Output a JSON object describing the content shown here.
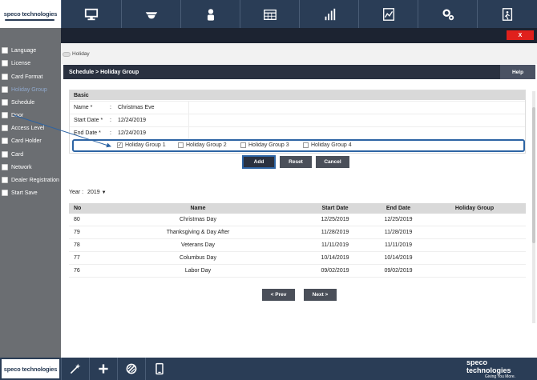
{
  "brand": {
    "logo_text": "speco technologies",
    "tagline": "Giving You More."
  },
  "nav": {
    "items": [
      {
        "icon": "monitor-icon"
      },
      {
        "icon": "camera-dome-icon"
      },
      {
        "icon": "user-icon"
      },
      {
        "icon": "calendar-icon"
      },
      {
        "icon": "bar-chart-icon"
      },
      {
        "icon": "report-icon"
      },
      {
        "icon": "settings-icon"
      },
      {
        "icon": "exit-icon"
      }
    ],
    "close_label": "X"
  },
  "sidebar": {
    "items": [
      {
        "label": "Language"
      },
      {
        "label": "License"
      },
      {
        "label": "Card Format"
      },
      {
        "label": "Holiday Group"
      },
      {
        "label": "Schedule"
      },
      {
        "label": "Door"
      },
      {
        "label": "Access Level"
      },
      {
        "label": "Card Holder"
      },
      {
        "label": "Card"
      },
      {
        "label": "Network"
      },
      {
        "label": "Dealer Registration"
      },
      {
        "label": "Start Save"
      }
    ]
  },
  "breadcrumb": "Holiday",
  "page": {
    "title": "Schedule > Holiday Group",
    "help_label": "Help"
  },
  "form": {
    "section_title": "Basic",
    "name_label": "Name *",
    "name_value": "Christmas Eve",
    "start_label": "Start Date *",
    "start_value": "12/24/2019",
    "end_label": "End Date *",
    "end_value": "12/24/2019",
    "colon": ":",
    "groups": [
      {
        "label": "Holiday Group 1",
        "checked": true
      },
      {
        "label": "Holiday Group 2",
        "checked": false
      },
      {
        "label": "Holiday Group 3",
        "checked": false
      },
      {
        "label": "Holiday Group 4",
        "checked": false
      }
    ],
    "check_mark": "✓",
    "add_label": "Add",
    "reset_label": "Reset",
    "cancel_label": "Cancel"
  },
  "year": {
    "label": "Year :",
    "value": "2019"
  },
  "table": {
    "headers": {
      "no": "No",
      "name": "Name",
      "start": "Start Date",
      "end": "End Date",
      "group": "Holiday Group"
    },
    "rows": [
      {
        "no": "80",
        "name": "Christmas Day",
        "start": "12/25/2019",
        "end": "12/25/2019",
        "group": ""
      },
      {
        "no": "79",
        "name": "Thanksgiving & Day After",
        "start": "11/28/2019",
        "end": "11/28/2019",
        "group": ""
      },
      {
        "no": "78",
        "name": "Veterans Day",
        "start": "11/11/2019",
        "end": "11/11/2019",
        "group": ""
      },
      {
        "no": "77",
        "name": "Columbus Day",
        "start": "10/14/2019",
        "end": "10/14/2019",
        "group": ""
      },
      {
        "no": "76",
        "name": "Labor Day",
        "start": "09/02/2019",
        "end": "09/02/2019",
        "group": ""
      }
    ]
  },
  "pager": {
    "prev_label": "< Prev",
    "next_label": "Next >"
  },
  "bottom": {
    "items": [
      {
        "icon": "magic-wand-icon"
      },
      {
        "icon": "plus-icon"
      },
      {
        "icon": "slash-circle-icon"
      },
      {
        "icon": "tablet-icon"
      }
    ]
  },
  "colors": {
    "navy": "#2a3d56",
    "accent_blue": "#2d64a4",
    "close_red": "#e0201c",
    "sidebar_gray": "#6b6e72"
  }
}
